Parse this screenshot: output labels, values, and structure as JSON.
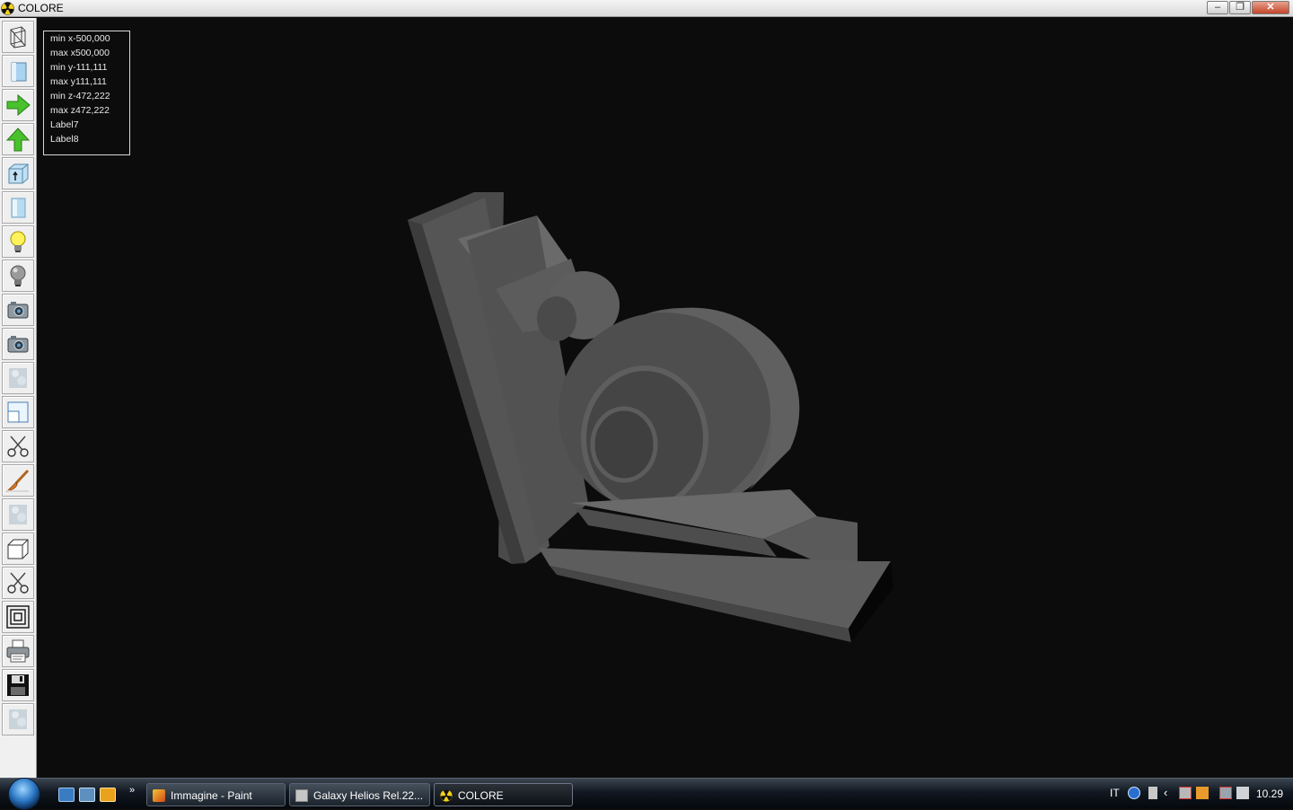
{
  "window": {
    "title": "COLORE",
    "app_icon": "radiation-icon",
    "controls": {
      "minimize": "–",
      "maximize": "❐",
      "close": "✕"
    }
  },
  "toolbar": {
    "buttons": [
      {
        "icon": "wireframe-icon"
      },
      {
        "icon": "cube-shaded-icon"
      },
      {
        "icon": "arrow-right-icon"
      },
      {
        "icon": "arrow-up-icon"
      },
      {
        "icon": "cube-arrow-icon"
      },
      {
        "icon": "cylinder-icon"
      },
      {
        "icon": "lightbulb-on-icon"
      },
      {
        "icon": "lightbulb-off-icon"
      },
      {
        "icon": "camera-icon"
      },
      {
        "icon": "camera-icon"
      },
      {
        "icon": "texture-icon"
      },
      {
        "icon": "window-split-icon"
      },
      {
        "icon": "scissors-icon"
      },
      {
        "icon": "paintbrush-icon"
      },
      {
        "icon": "texture-icon"
      },
      {
        "icon": "box-outline-icon"
      },
      {
        "icon": "scissors-icon"
      },
      {
        "icon": "nested-squares-icon"
      },
      {
        "icon": "printer-icon"
      },
      {
        "icon": "floppy-disk-icon"
      },
      {
        "icon": "texture-icon"
      }
    ]
  },
  "info": {
    "min_x": "min x-500,000",
    "max_x": "max x500,000",
    "min_y": "min y-111,111",
    "max_y": "max y111,111",
    "min_z": "min z-472,222",
    "max_z": "max z472,222",
    "label7": "Label7",
    "label8": "Label8"
  },
  "taskbar": {
    "quicklaunch_more": "»",
    "tasks": [
      {
        "label": "Immagine - Paint",
        "icon": "paint-icon"
      },
      {
        "label": "Galaxy Helios  Rel.22...",
        "icon": "folder-icon"
      },
      {
        "label": "COLORE",
        "icon": "radiation-icon"
      }
    ],
    "language": "IT",
    "clock": "10.29"
  },
  "colors": {
    "viewport_bg": "#0c0c0c",
    "model_gray": "#5a5a5a",
    "taskbar": "#111821"
  }
}
